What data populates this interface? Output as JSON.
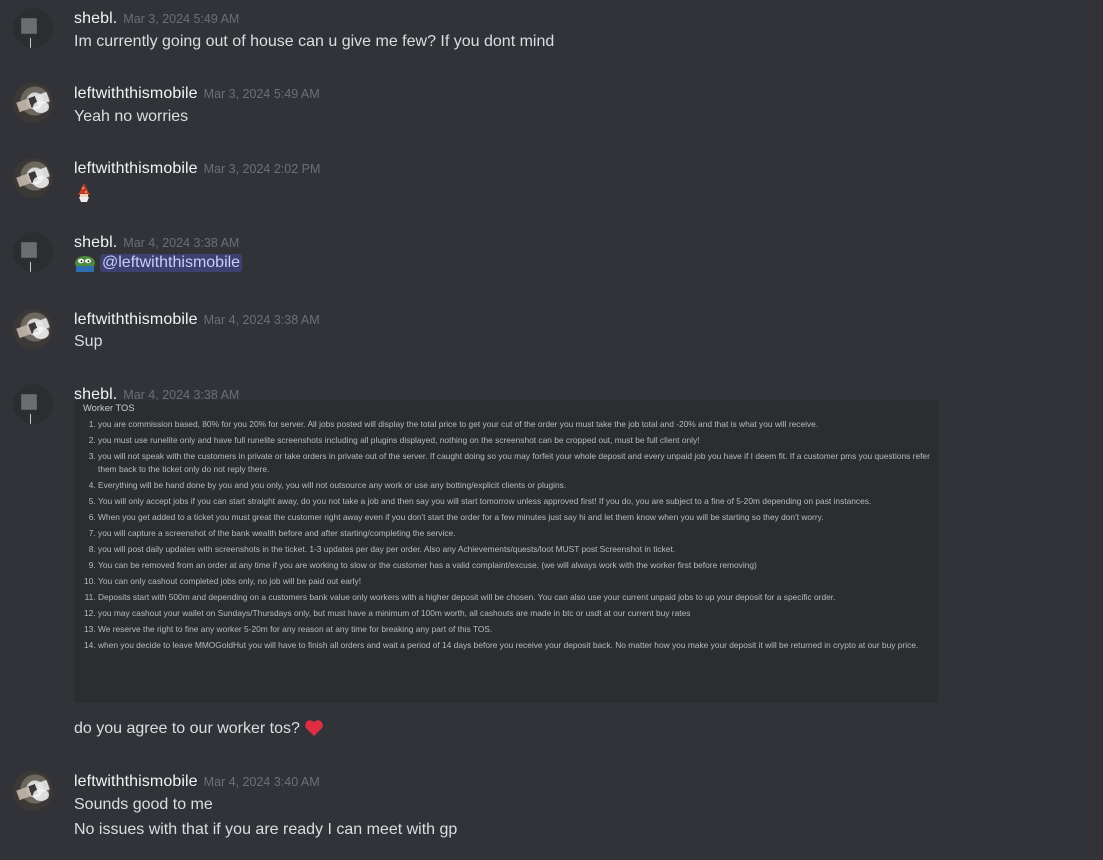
{
  "messages": [
    {
      "author": "shebl.",
      "timestamp": "Mar 3, 2024 5:49 AM",
      "lines": [
        "Im currently going out of house can u give me few? If you dont mind"
      ]
    },
    {
      "author": "leftwiththismobile",
      "timestamp": "Mar 3, 2024 5:49 AM",
      "lines": [
        "Yeah no worries"
      ]
    },
    {
      "author": "leftwiththismobile",
      "timestamp": "Mar 3, 2024 2:02 PM",
      "emoji": "wizard-emoji"
    },
    {
      "author": "shebl.",
      "timestamp": "Mar 4, 2024 3:38 AM",
      "emoji": "pepe-emoji",
      "mention": "@leftwiththismobile"
    },
    {
      "author": "leftwiththismobile",
      "timestamp": "Mar 4, 2024 3:38 AM",
      "lines": [
        "Sup"
      ]
    },
    {
      "author": "shebl.",
      "timestamp": "Mar 4, 2024 3:38 AM",
      "attachment": {
        "title": "Worker TOS",
        "items": [
          "you are commission based, 80% for you 20% for server. All jobs posted will display the total price to get your cut of the order you must take the job total and -20% and that is what you will receive.",
          "you must use runelite only and have full runelite screenshots including all plugins displayed, nothing on the screenshot can be cropped out, must be full client only!",
          "you will not speak with the customers in private or take orders in private out of the server. If caught doing so you may forfeit your whole deposit and every unpaid job you have if I deem fit. If a customer pms you questions refer them back to the ticket only do not reply there.",
          "Everything will be hand done by you and you only, you will not outsource any work or use any botting/explicit clients or plugins.",
          "You will only accept jobs if you can start straight away, do you not take a job and then say you will start tomorrow unless approved first! If you do, you are subject to a fine of 5-20m depending on past instances.",
          "When you get added to a ticket you must great the customer right away even if you don't start the order for a few minutes just say hi and let them know when you will be starting so they don't worry.",
          "you will capture a screenshot of the bank wealth before and after starting/completing the service.",
          "you will post daily updates with screenshots in the ticket. 1-3 updates per day per order. Also any Achievements/quests/loot MUST post Screenshot in ticket.",
          "You can be removed from an order at any time if you are working to slow or the customer has a valid complaint/excuse. (we will always work with the worker first before removing)",
          "You can only cashout completed jobs only, no job will be paid out early!",
          "Deposits start with 500m and depending on a customers bank value only workers with a higher deposit will be chosen. You can also use your current unpaid jobs to up your deposit for a specific order.",
          "you may cashout your wallet on Sundays/Thursdays only, but must have a minimum of 100m worth, all cashouts are made in btc or usdt at our current buy rates",
          "We reserve the right to fine any worker 5-20m for any reason at any time for breaking any part of this TOS.",
          "when you decide to leave MMOGoldHut you will have to finish all orders and wait a period of 14 days before you receive your deposit back. No matter how you make your deposit it will be returned in crypto at our buy price."
        ]
      },
      "lines": [
        "do you agree to our worker tos?"
      ],
      "trailing_emoji": "red-heart-emoji"
    },
    {
      "author": "leftwiththismobile",
      "timestamp": "Mar 4, 2024 3:40 AM",
      "lines": [
        "Sounds good to me",
        "No issues with that if you are ready I can meet with gp"
      ]
    }
  ]
}
